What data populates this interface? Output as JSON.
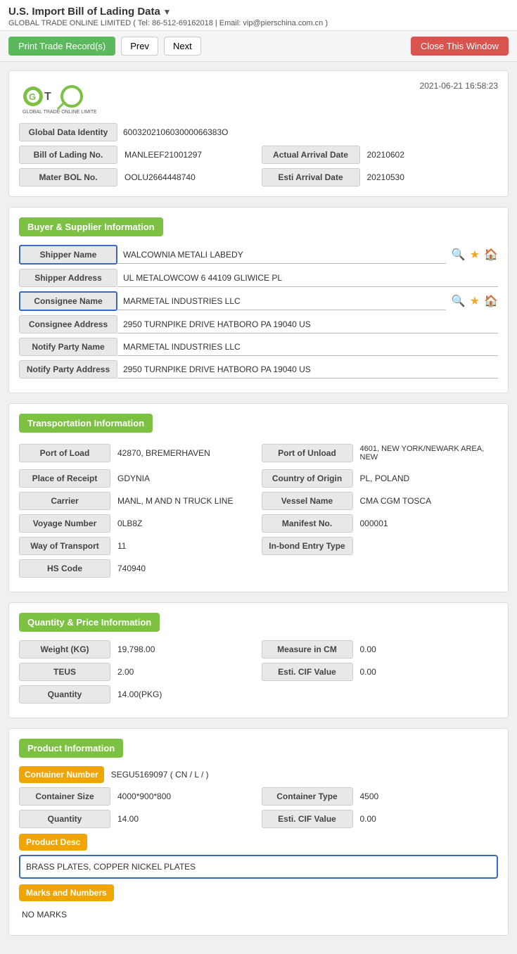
{
  "header": {
    "title": "U.S. Import Bill of Lading Data",
    "dropdown_arrow": "▼",
    "subtitle": "GLOBAL TRADE ONLINE LIMITED ( Tel: 86-512-69162018 | Email: vip@pierschina.com.cn )"
  },
  "toolbar": {
    "print_label": "Print Trade Record(s)",
    "prev_label": "Prev",
    "next_label": "Next",
    "close_label": "Close This Window"
  },
  "logo": {
    "company": "GLOBAL TRADE ONLINE LIMITED",
    "timestamp": "2021-06-21 16:58:23"
  },
  "basic_info": {
    "global_data_identity_label": "Global Data Identity",
    "global_data_identity_value": "600320210603000066383O",
    "bill_of_lading_label": "Bill of Lading No.",
    "bill_of_lading_value": "MANLEEF21001297",
    "actual_arrival_date_label": "Actual Arrival Date",
    "actual_arrival_date_value": "20210602",
    "mater_bol_label": "Mater BOL No.",
    "mater_bol_value": "OOLU2664448740",
    "esti_arrival_date_label": "Esti Arrival Date",
    "esti_arrival_date_value": "20210530"
  },
  "buyer_supplier": {
    "section_title": "Buyer & Supplier Information",
    "shipper_name_label": "Shipper Name",
    "shipper_name_value": "WALCOWNIA METALI LABEDY",
    "shipper_address_label": "Shipper Address",
    "shipper_address_value": "UL METALOWCOW 6 44109 GLIWICE PL",
    "consignee_name_label": "Consignee Name",
    "consignee_name_value": "MARMETAL INDUSTRIES LLC",
    "consignee_address_label": "Consignee Address",
    "consignee_address_value": "2950 TURNPIKE DRIVE HATBORO PA 19040 US",
    "notify_party_name_label": "Notify Party Name",
    "notify_party_name_value": "MARMETAL INDUSTRIES LLC",
    "notify_party_address_label": "Notify Party Address",
    "notify_party_address_value": "2950 TURNPIKE DRIVE HATBORO PA 19040 US"
  },
  "transportation": {
    "section_title": "Transportation Information",
    "port_of_load_label": "Port of Load",
    "port_of_load_value": "42870, BREMERHAVEN",
    "port_of_unload_label": "Port of Unload",
    "port_of_unload_value": "4601, NEW YORK/NEWARK AREA, NEW",
    "place_of_receipt_label": "Place of Receipt",
    "place_of_receipt_value": "GDYNIA",
    "country_of_origin_label": "Country of Origin",
    "country_of_origin_value": "PL, POLAND",
    "carrier_label": "Carrier",
    "carrier_value": "MANL, M AND N TRUCK LINE",
    "vessel_name_label": "Vessel Name",
    "vessel_name_value": "CMA CGM TOSCA",
    "voyage_number_label": "Voyage Number",
    "voyage_number_value": "0LB8Z",
    "manifest_no_label": "Manifest No.",
    "manifest_no_value": "000001",
    "way_of_transport_label": "Way of Transport",
    "way_of_transport_value": "11",
    "in_bond_entry_type_label": "In-bond Entry Type",
    "in_bond_entry_type_value": "",
    "hs_code_label": "HS Code",
    "hs_code_value": "740940"
  },
  "quantity_price": {
    "section_title": "Quantity & Price Information",
    "weight_kg_label": "Weight (KG)",
    "weight_kg_value": "19,798.00",
    "measure_in_cm_label": "Measure in CM",
    "measure_in_cm_value": "0.00",
    "teus_label": "TEUS",
    "teus_value": "2.00",
    "esti_cif_value_label": "Esti. CIF Value",
    "esti_cif_value_value": "0.00",
    "quantity_label": "Quantity",
    "quantity_value": "14.00(PKG)"
  },
  "product_info": {
    "section_title": "Product Information",
    "container_number_label": "Container Number",
    "container_number_value": "SEGU5169097 ( CN / L / )",
    "container_size_label": "Container Size",
    "container_size_value": "4000*900*800",
    "container_type_label": "Container Type",
    "container_type_value": "4500",
    "quantity_label": "Quantity",
    "quantity_value": "14.00",
    "esti_cif_value_label": "Esti. CIF Value",
    "esti_cif_value_value": "0.00",
    "product_desc_label": "Product Desc",
    "product_desc_value": "BRASS PLATES, COPPER NICKEL PLATES",
    "marks_and_numbers_label": "Marks and Numbers",
    "marks_and_numbers_value": "NO MARKS"
  }
}
